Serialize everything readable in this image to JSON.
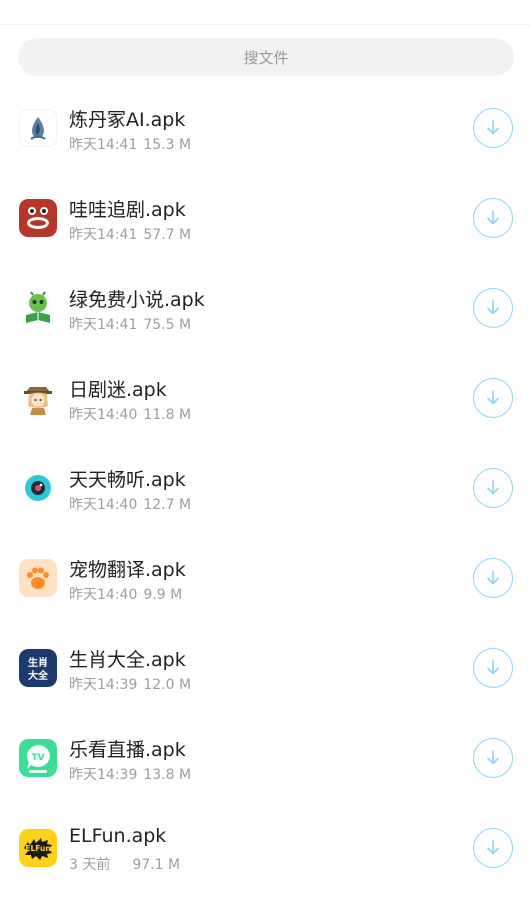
{
  "search": {
    "placeholder": "搜文件"
  },
  "files": [
    {
      "name": "炼丹冢AI.apk",
      "time": "昨天14:41",
      "size": "15.3 M",
      "icon": "alchemy-app-icon"
    },
    {
      "name": "哇哇追剧.apk",
      "time": "昨天14:41",
      "size": "57.7 M",
      "icon": "wawa-drama-app-icon"
    },
    {
      "name": "绿免费小说.apk",
      "time": "昨天14:41",
      "size": "75.5 M",
      "icon": "green-novel-app-icon"
    },
    {
      "name": "日剧迷.apk",
      "time": "昨天14:40",
      "size": "11.8 M",
      "icon": "jdrama-fan-app-icon"
    },
    {
      "name": "天天畅听.apk",
      "time": "昨天14:40",
      "size": "12.7 M",
      "icon": "daily-listen-app-icon"
    },
    {
      "name": "宠物翻译.apk",
      "time": "昨天14:40",
      "size": "9.9 M",
      "icon": "pet-translate-app-icon"
    },
    {
      "name": "生肖大全.apk",
      "time": "昨天14:39",
      "size": "12.0 M",
      "icon": "zodiac-app-icon",
      "icon_text": [
        "生肖",
        "大全"
      ]
    },
    {
      "name": "乐看直播.apk",
      "time": "昨天14:39",
      "size": "13.8 M",
      "icon": "lekan-live-app-icon",
      "icon_text": [
        "TV"
      ]
    },
    {
      "name": "ELFun.apk",
      "time": "3 天前",
      "size": "97.1 M",
      "icon": "elfun-app-icon",
      "icon_text": [
        "ELFun"
      ]
    }
  ],
  "colors": {
    "download_ring": "#8fd3f5",
    "title": "#222222",
    "meta": "#9e9e9e"
  }
}
